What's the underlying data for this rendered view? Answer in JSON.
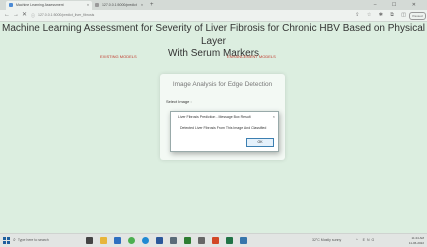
{
  "browser": {
    "tabs": [
      {
        "label": "Machine Learning Assessment",
        "close": "×"
      },
      {
        "label": "127.0.0.1:5000/predict",
        "close": "×"
      }
    ],
    "new_tab": "+",
    "window_controls": "– ☐ ✕",
    "url": "127.0.0.1:5000/predict_liver_fibrosis",
    "profile": "Paused"
  },
  "page": {
    "title_line1": "Machine Learning Assessment for Severity of Liver Fibrosis for Chronic HBV Based on Physical Layer",
    "title_line2": "With Serum Markers",
    "nav": [
      {
        "label": "EXISTING MODELS"
      },
      {
        "label": "ENHANCEMENT MODELS"
      }
    ]
  },
  "card": {
    "title": "Image Analysis for Edge Detection",
    "select_label": "Select Image :"
  },
  "dialog": {
    "title": "Liver Fibrosis Prediction - Message Box Result",
    "close": "×",
    "message": "Detected Liver Fibrosis From This Image And Classified",
    "ok_label": "OK"
  },
  "taskbar": {
    "search_placeholder": "Type here to search",
    "weather": "32°C Mostly sunny",
    "tray": "^ ENG",
    "time": "11:24 AM",
    "date": "11-06-2022"
  },
  "icons": {
    "taskbar": [
      "task-view-icon",
      "file-explorer-icon",
      "mail-icon",
      "chrome-icon",
      "edge-icon",
      "word-icon",
      "store-icon",
      "photos-icon",
      "settings-icon",
      "powerpoint-icon",
      "excel-icon",
      "python-icon"
    ]
  },
  "colors": {
    "page_background": "#dceee0",
    "nav_link": "#c0392b",
    "dialog_button_border": "#3c7fb1"
  }
}
